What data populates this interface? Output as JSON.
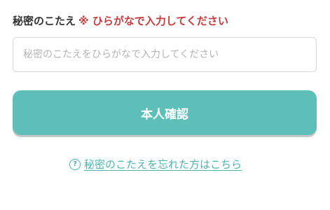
{
  "form": {
    "label": "秘密のこたえ",
    "note": "※ ひらがなで入力してください",
    "input_value": "",
    "input_placeholder": "秘密のこたえをひらがなで入力してください",
    "submit_label": "本人確認",
    "forgot_link_text": "秘密のこたえを忘れた方はこちら",
    "help_icon_glyph": "?"
  },
  "colors": {
    "accent": "#5ebfb9",
    "link": "#4fb3ad",
    "warning": "#c43d3d",
    "label_text": "#333333",
    "placeholder": "#b3b3b3"
  },
  "icons": {
    "help": "question-circle-icon"
  }
}
